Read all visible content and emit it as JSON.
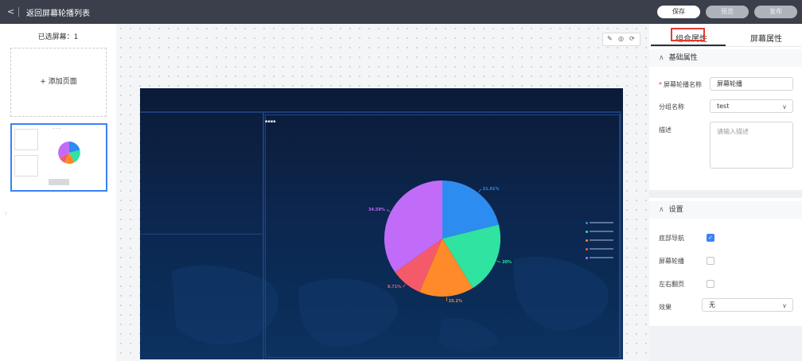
{
  "topbar": {
    "back_icon": "chevron-left-icon",
    "title": "返回屏幕轮播列表",
    "save_label": "保存",
    "preview_label": "预览",
    "publish_label": "发布"
  },
  "left": {
    "selected_count_label": "已选屏幕：1",
    "add_page_label": "+ 添加页面",
    "side_marker": ":"
  },
  "toolbar": {
    "edit_icon": "pencil-icon",
    "view_icon": "eye-icon",
    "refresh_icon": "refresh-icon",
    "edit_glyph": "✎",
    "view_glyph": "◎",
    "refresh_glyph": "⟳"
  },
  "chart_data": {
    "type": "pie",
    "title": "",
    "slices": [
      {
        "value": 21.01,
        "label": "21.01%",
        "color": "#2d8cf0"
      },
      {
        "value": 20,
        "label": "20%",
        "color": "#30e3a0"
      },
      {
        "value": 15.1,
        "label": "15.1%",
        "color": "#ff8a2a"
      },
      {
        "value": 8.71,
        "label": "8.71%",
        "color": "#f55a6a"
      },
      {
        "value": 34.59,
        "label": "34.59%",
        "color": "#c06cf9"
      }
    ],
    "legend_placement": "right"
  },
  "right": {
    "tabs": [
      "组合属性",
      "屏幕属性"
    ],
    "basic_section": "基础属性",
    "fields": {
      "name_label": "屏幕轮播名称",
      "name_value": "屏幕轮播",
      "group_label": "分组名称",
      "group_value": "test",
      "desc_label": "描述",
      "desc_placeholder": "请输入描述"
    },
    "settings_section": "设置",
    "settings": {
      "nav_label": "底部导航",
      "nav_checked": true,
      "carousel_label": "屏幕轮播",
      "carousel_checked": false,
      "flip_label": "左右翻页",
      "flip_checked": false,
      "effect_label": "效果",
      "effect_value": "无"
    }
  }
}
